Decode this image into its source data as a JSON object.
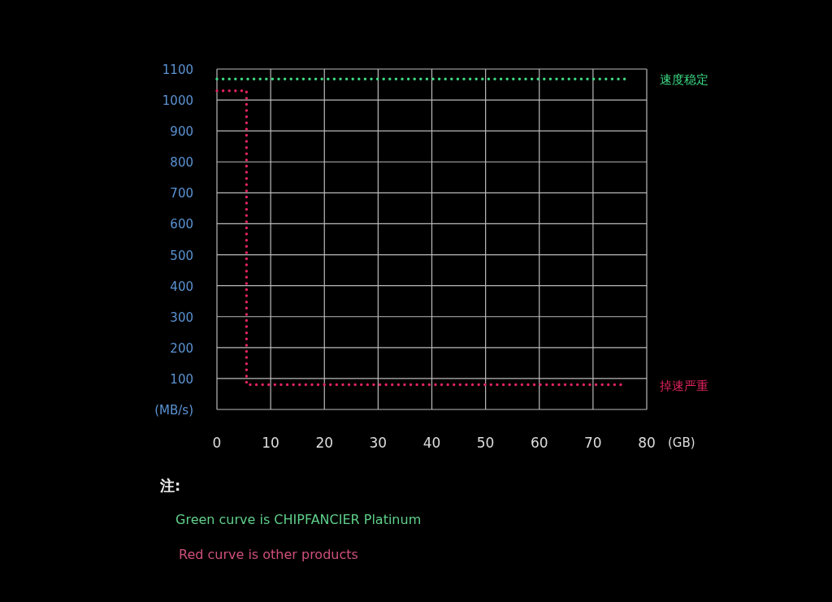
{
  "chart": {
    "chart_data": {
      "type": "line",
      "xlabel": "(GB)",
      "xlim": [
        0,
        80
      ],
      "ylim": [
        0,
        1100
      ],
      "grid": true,
      "xticks": [
        0,
        10,
        20,
        30,
        40,
        50,
        60,
        70,
        80
      ],
      "yticks": [
        {
          "value": 0,
          "label": "(MB/s)"
        },
        100,
        200,
        300,
        400,
        500,
        600,
        700,
        800,
        900,
        1000,
        1100
      ],
      "x": [
        0,
        5.5,
        5.5,
        76
      ],
      "series": [
        {
          "color": "#3ddc84",
          "line_style": "dotted",
          "values": [
            1068,
            1068,
            1068,
            1068
          ]
        },
        {
          "color": "#e0245e",
          "line_style": "dotted",
          "values": [
            1030,
            1030,
            80,
            80
          ]
        }
      ],
      "annotations": [
        "速度稳定",
        "掉速严重"
      ]
    }
  },
  "notes": {
    "title": "注:",
    "lines": [
      {
        "text": "Green curve is CHIPFANCIER Platinum",
        "color": "#5fcf8a"
      },
      {
        "text": "Red curve is other products",
        "color": "#d0507a"
      }
    ]
  }
}
